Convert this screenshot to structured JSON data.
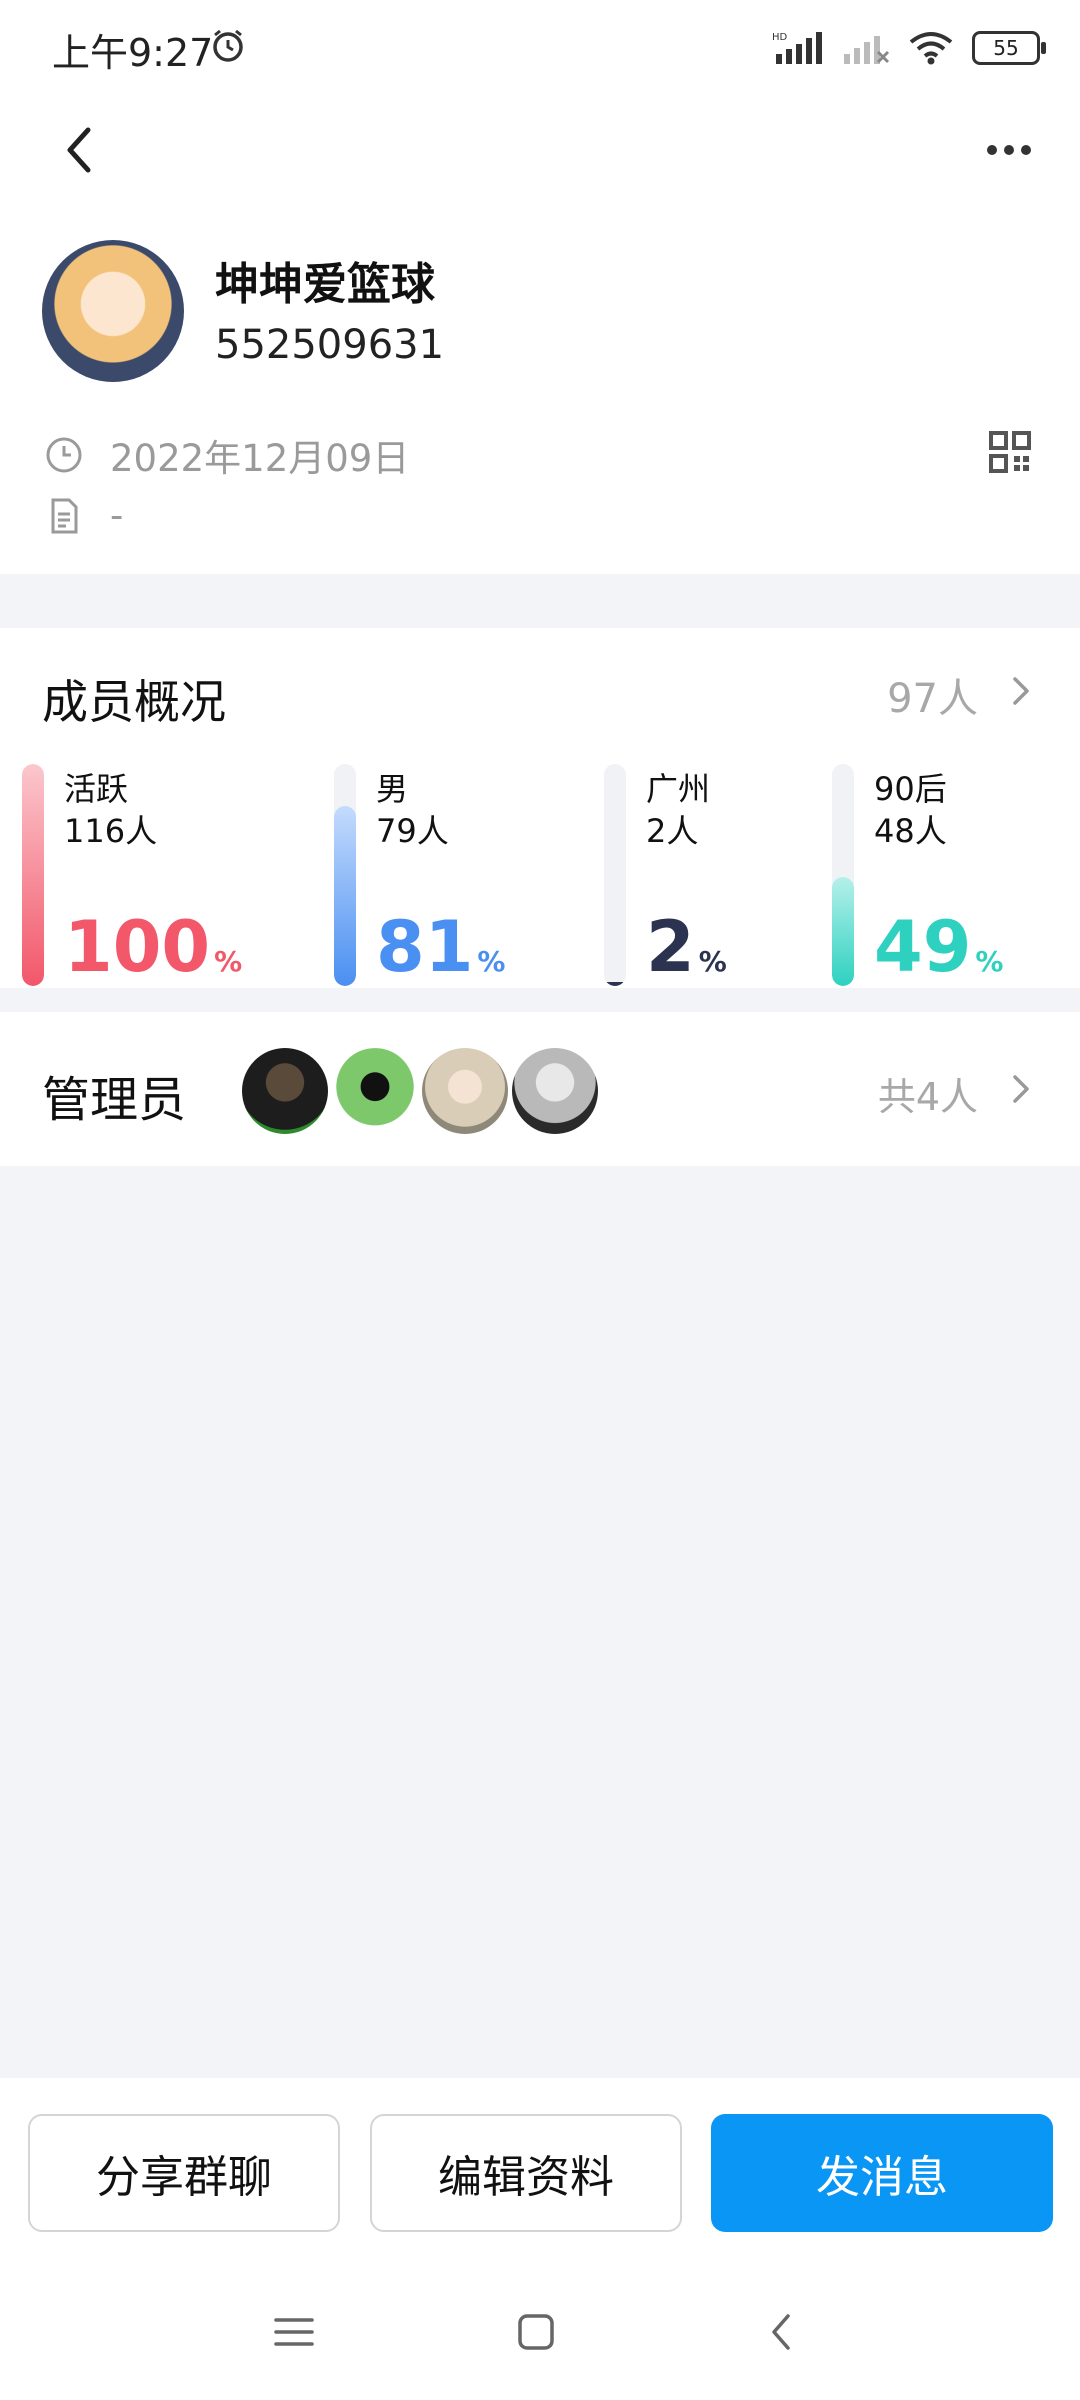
{
  "status_bar": {
    "time": "上午9:27",
    "battery": "55"
  },
  "header": {
    "back_icon": "chevron-left-icon",
    "more_icon": "more-dots-icon"
  },
  "group": {
    "name": "坤坤爱篮球",
    "id": "552509631",
    "created_date": "2022年12月09日",
    "description": "-"
  },
  "members": {
    "title": "成员概况",
    "total": "97人",
    "stats": [
      {
        "label": "活跃",
        "count": "116人",
        "percent": "100",
        "level": 1.0,
        "color": "#f2576a",
        "track_top": "#fbc7cd"
      },
      {
        "label": "男",
        "count": "79人",
        "percent": "81",
        "level": 0.81,
        "color": "#4a8ff2",
        "track_top": "#c4dbfc"
      },
      {
        "label": "广州",
        "count": "2人",
        "percent": "2",
        "level": 0.02,
        "color": "#2b3350",
        "track_top": "#2b3350"
      },
      {
        "label": "90后",
        "count": "48人",
        "percent": "49",
        "level": 0.49,
        "color": "#2ed1c0",
        "track_top": "#b5f0ea"
      }
    ],
    "percent_sign": "%"
  },
  "admins": {
    "title": "管理员",
    "count": "共4人"
  },
  "actions": {
    "share": "分享群聊",
    "edit": "编辑资料",
    "message": "发消息"
  },
  "colors": {
    "primary": "#0a96f5"
  }
}
